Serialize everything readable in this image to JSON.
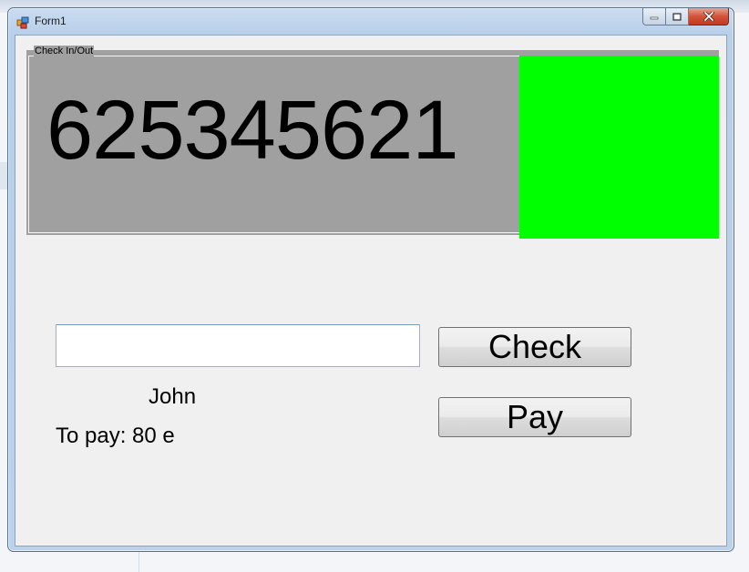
{
  "window": {
    "title": "Form1"
  },
  "groupbox": {
    "label": "Check In/Out",
    "number": "625345621",
    "status_color": "#00ff00",
    "background_color": "#a0a0a0"
  },
  "form": {
    "input_value": "",
    "check_label": "Check",
    "pay_label": "Pay",
    "name": "John",
    "to_pay": "To pay: 80 e"
  },
  "icons": {
    "app": "app-form-icon",
    "minimize": "minimize-icon",
    "maximize": "maximize-icon",
    "close": "close-icon"
  }
}
